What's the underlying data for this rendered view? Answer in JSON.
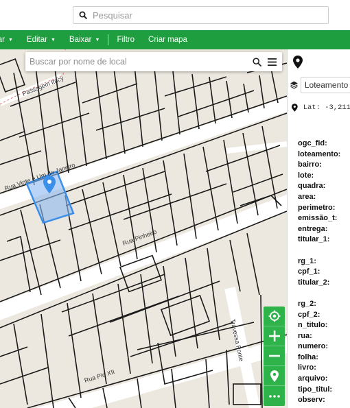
{
  "header": {
    "search_placeholder": "Pesquisar"
  },
  "menu": [
    {
      "label": "zar",
      "caret": true
    },
    {
      "label": "Editar",
      "caret": true
    },
    {
      "label": "Baixar",
      "caret": true
    },
    {
      "label": "Filtro",
      "caret": false
    },
    {
      "label": "Criar mapa",
      "caret": false
    }
  ],
  "map": {
    "place_search_placeholder": "Buscar por nome de local",
    "street_labels": [
      "Rua Vinte e Um de Janeiro",
      "Rua Pinheiro",
      "Rua Pio XII",
      "Travessa Ponte",
      "Passagem Itacy"
    ],
    "controls": [
      "locate-icon",
      "zoom-in-icon",
      "zoom-out-icon",
      "marker-icon",
      "more-icon"
    ],
    "accent": "#2db34a",
    "selection_color": "#3b8fe8"
  },
  "panel": {
    "layer_value": "Loteamento",
    "coords_text": "Lat: -3,211",
    "attributes": [
      "ogc_fid:",
      "loteamento:",
      "bairro:",
      "lote:",
      "quadra:",
      "area:",
      "perimetro:",
      "emissão_t:",
      "entrega:",
      "titular_1:",
      "",
      "rg_1:",
      "cpf_1:",
      "titular_2:",
      "",
      "rg_2:",
      "cpf_2:",
      "n_titulo:",
      "rua:",
      "numero:",
      "folha:",
      "livro:",
      "arquivo:",
      "tipo_titul:",
      "observ:"
    ]
  },
  "colors": {
    "menu_green": "#1e9e3f",
    "map_bg": "#ece8df",
    "road": "#ffffff",
    "parcel_line": "#1a1a1a"
  }
}
